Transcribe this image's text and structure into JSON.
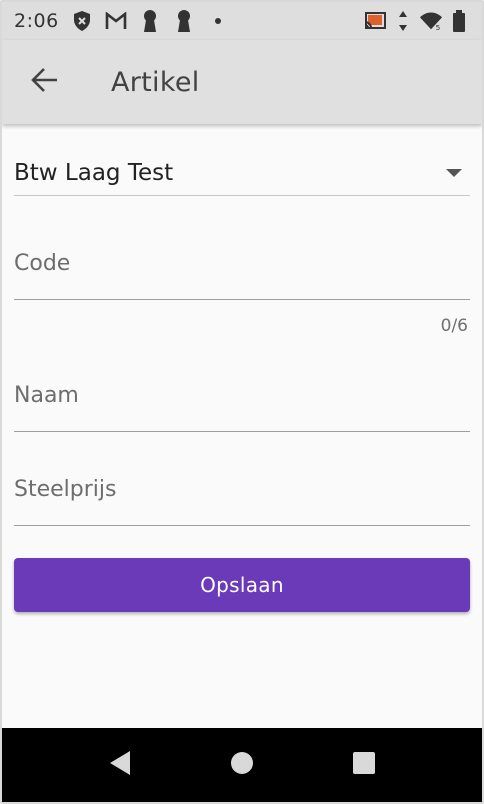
{
  "status_bar": {
    "time": "2:06",
    "icons_left": [
      "shield-x-icon",
      "gmail-icon",
      "keyhole-icon",
      "keyhole-icon",
      "dot-icon"
    ],
    "icons_right": [
      "cast-icon",
      "data-arrows-icon",
      "wifi-icon",
      "battery-icon"
    ]
  },
  "app_bar": {
    "back_icon": "arrow-back-icon",
    "title": "Artikel",
    "background": "#e0e0e0"
  },
  "form": {
    "vat_dropdown": {
      "selected": "Btw Laag Test",
      "icon": "caret-down-icon"
    },
    "code": {
      "placeholder": "Code",
      "value": "",
      "counter": "0/6"
    },
    "name": {
      "placeholder": "Naam",
      "value": ""
    },
    "price": {
      "placeholder": "Steelprijs",
      "value": ""
    },
    "save_label": "Opslaan",
    "save_color": "#6b3ab8"
  },
  "nav_bar": {
    "buttons": [
      "back-triangle-icon",
      "home-circle-icon",
      "recents-square-icon"
    ]
  }
}
